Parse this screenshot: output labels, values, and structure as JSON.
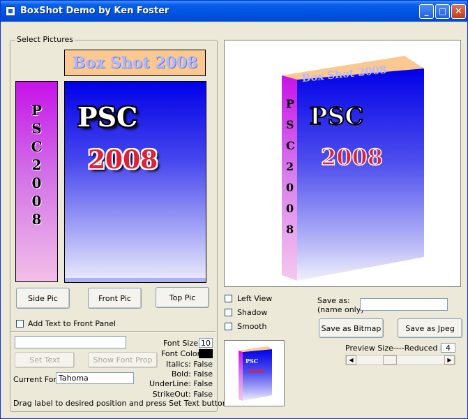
{
  "window": {
    "title": "BoxShot Demo by Ken Foster"
  },
  "select_pictures": {
    "group_title": "Select Pictures",
    "top_panel_text": "Box Shot 2008",
    "side_panel_letters": [
      "P",
      "S",
      "C",
      "2",
      "0",
      "0",
      "8"
    ],
    "front_panel_line1": "PSC",
    "front_panel_line2": "2008",
    "side_pic_label": "Side Pic",
    "front_pic_label": "Front Pic",
    "top_pic_label": "Top Pic"
  },
  "text_options": {
    "add_text_label": "Add Text to Front Panel",
    "text_input_value": "",
    "set_text_label": "Set Text",
    "show_font_prop_label": "Show Font Prop",
    "current_font_label": "Current Font",
    "current_font_value": "Tahoma",
    "font_size_label": "Font Size",
    "font_size_value": "10",
    "font_color_label": "Font Color",
    "font_color_value": "#000000",
    "italics_label": "Italics: False",
    "bold_label": "Bold: False",
    "underline_label": "UnderLine: False",
    "strikeout_label": "StrikeOut: False",
    "hint": "Drag label to desired position and press Set Text button"
  },
  "view_options": {
    "left_view_label": "Left View",
    "shadow_label": "Shadow",
    "smooth_label": "Smooth"
  },
  "save": {
    "save_as_label": "Save as:",
    "name_only_label": "(name only)",
    "name_value": "",
    "save_bitmap_label": "Save as Bitmap",
    "save_jpeg_label": "Save as Jpeg"
  },
  "preview": {
    "size_label": "Preview Size----Reduced by",
    "reduced_by_value": "4",
    "box_top_text": "Box Shot 2008",
    "box_front_line1": "PSC",
    "box_front_line2": "2008",
    "slider_level": 0.35
  },
  "colors": {
    "titlebar": "#0054e3",
    "window_bg": "#ece9d8",
    "side_panel": "#c612e8",
    "front_panel": "#0000e8",
    "top_panel": "#fbc890",
    "year_text": "#e0203a"
  }
}
